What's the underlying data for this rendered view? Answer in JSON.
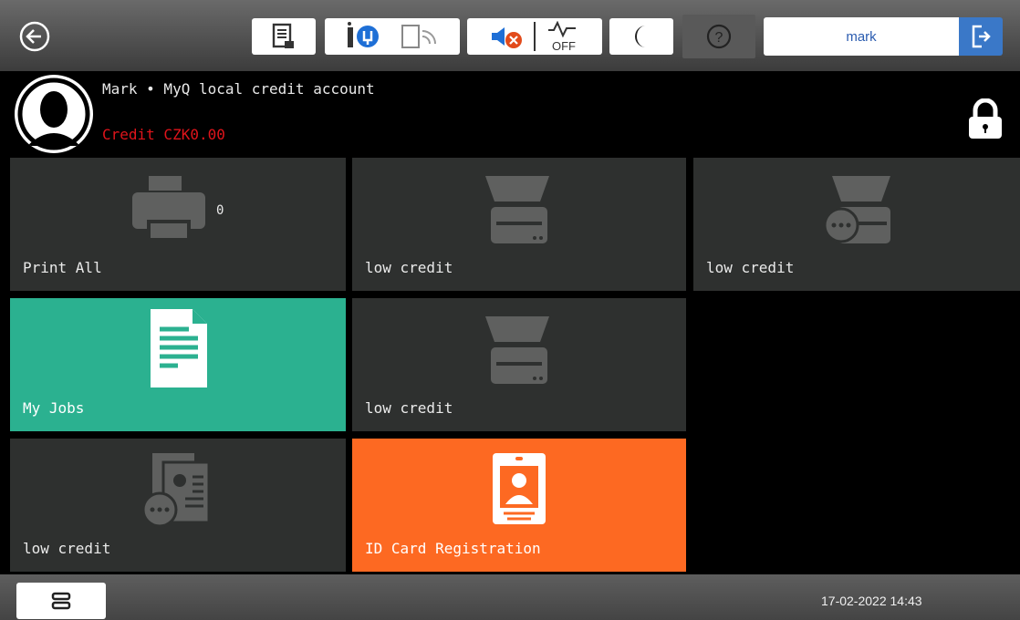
{
  "user": {
    "name": "mark"
  },
  "account": {
    "title": "Mark • MyQ local credit account",
    "credit": "Credit CZK0.00"
  },
  "tiles": [
    {
      "label": "Print All",
      "count": "0"
    },
    {
      "label": "low credit"
    },
    {
      "label": "low credit"
    },
    {
      "label": "My Jobs"
    },
    {
      "label": "low credit"
    },
    {
      "label": "low credit"
    },
    {
      "label": "ID Card Registration"
    }
  ],
  "footer": {
    "datetime": "17-02-2022 14:43"
  },
  "icons": [
    "back-arrow-icon",
    "document-icon",
    "ink-icon",
    "wifi-icon",
    "mute-icon",
    "eco-off-icon",
    "moon-icon",
    "help-icon",
    "logout-icon",
    "lock-icon",
    "printer-icon",
    "scanner-icon",
    "scanner-more-icon",
    "document-lines-icon",
    "copy-more-icon",
    "id-card-icon",
    "menu-icon"
  ],
  "colors": {
    "green": "#2bb190",
    "orange": "#fd6922",
    "credit": "#e0141b",
    "blue": "#3a78c8"
  }
}
